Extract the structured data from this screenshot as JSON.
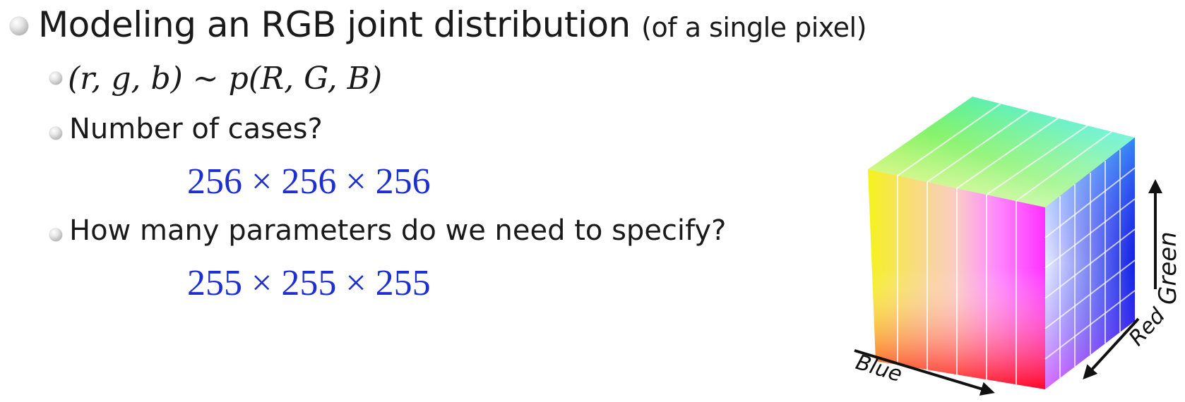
{
  "slide": {
    "title": "Modeling an RGB joint distribution",
    "title_suffix": "(of a single pixel)",
    "bullets": [
      {
        "text": "(r, g, b) ~ p(R, G, B)"
      },
      {
        "text": "Number of cases?",
        "answer": "256 × 256 × 256"
      },
      {
        "text": "How many parameters do we need to specify?",
        "answer": "255 × 255 × 255"
      }
    ]
  },
  "figure": {
    "axis_labels": {
      "green": "Green",
      "red": "Red",
      "blue": "Blue"
    }
  }
}
